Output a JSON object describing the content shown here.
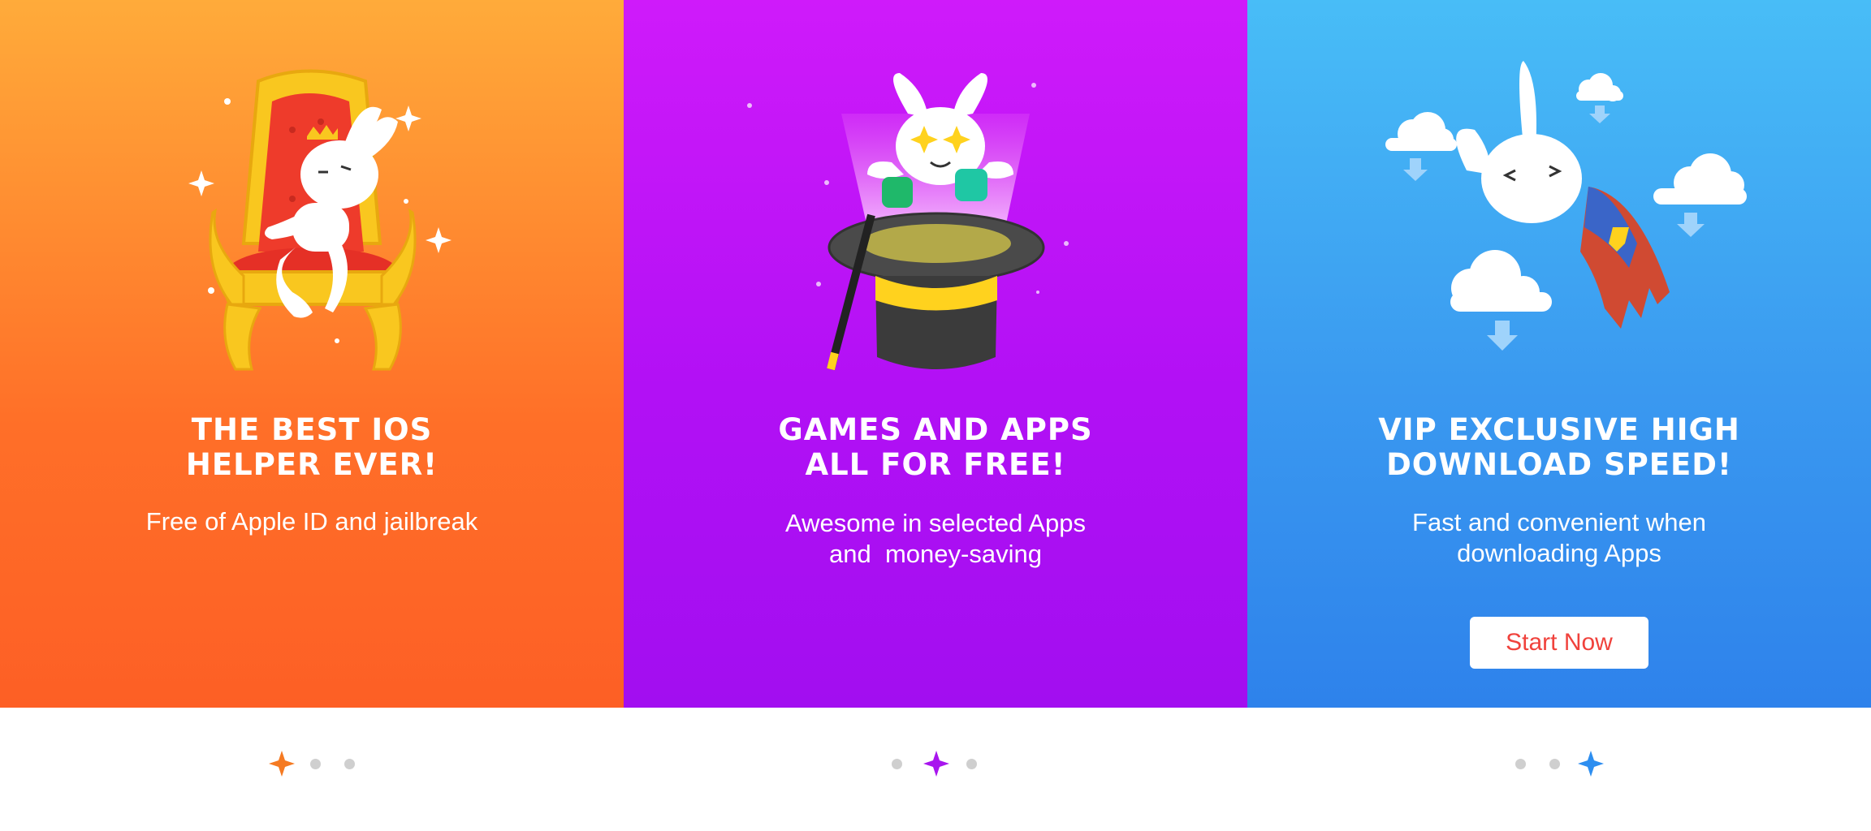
{
  "panels": [
    {
      "title_line1": "THE BEST IOS",
      "title_line2": "HELPER EVER!",
      "subtitle_line1": "Free of Apple ID and jailbreak",
      "subtitle_line2": ""
    },
    {
      "title_line1": "GAMES AND APPS",
      "title_line2": "ALL FOR FREE!",
      "subtitle_line1": "Awesome in selected Apps",
      "subtitle_line2": "and  money-saving"
    },
    {
      "title_line1": "VIP EXCLUSIVE HIGH",
      "title_line2": "DOWNLOAD SPEED!",
      "subtitle_line1": "Fast and convenient when",
      "subtitle_line2": "downloading Apps",
      "button_label": "Start Now"
    }
  ],
  "pagination": {
    "count": 3,
    "active_colors": [
      "#f57a22",
      "#a815ee",
      "#2d8ef0"
    ],
    "inactive_color": "#cfcfcf"
  },
  "icons": [
    "throne-rabbit-illustration",
    "magic-hat-rabbit-illustration",
    "superhero-rabbit-illustration",
    "sparkle-star-icon"
  ]
}
